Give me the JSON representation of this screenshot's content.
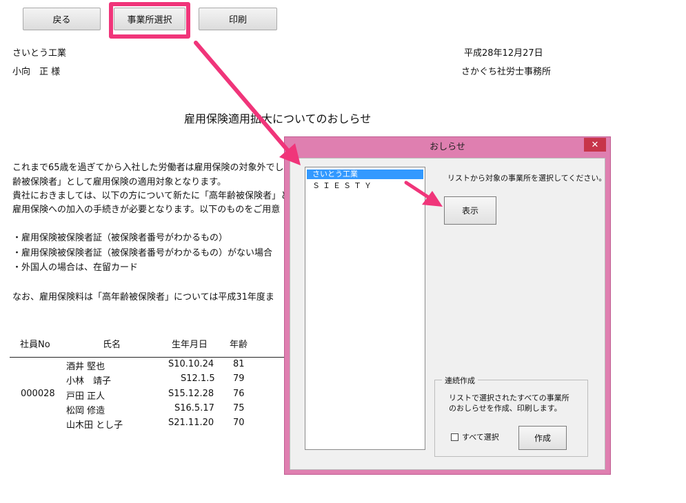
{
  "toolbar": {
    "back_label": "戻る",
    "select_office_label": "事業所選択",
    "print_label": "印刷"
  },
  "document": {
    "company": "さいとう工業",
    "recipient": "小向　正 様",
    "date": "平成28年12月27日",
    "sender": "さかぐち社労士事務所",
    "title": "雇用保険適用拡大についてのおしらせ",
    "lines": [
      "これまで65歳を過ぎてから入社した労働者は雇用保険の対象外でし",
      "齢被保険者」として雇用保険の適用対象となります。",
      "貴社におきましては、以下の方について新たに「高年齢被保険者」と",
      "雇用保険への加入の手続きが必要となります。以下のものをご用意",
      "",
      "・雇用保険被保険者証（被保険者番号がわかるもの）",
      "・雇用保険被保険者証（被保険者番号がわかるもの）がない場合",
      "・外国人の場合は、在留カード",
      "",
      "なお、雇用保険料は「高年齢被保険者」については平成31年度ま"
    ],
    "table": {
      "headers": [
        "社員No",
        "氏名",
        "生年月日",
        "年齢"
      ],
      "employee_no": "000028",
      "rows": [
        {
          "name": "酒井 堅也",
          "birth": "S10.10.24",
          "age": "81"
        },
        {
          "name": "小林　靖子",
          "birth": "S12.1.5",
          "age": "79"
        },
        {
          "name": "戸田 正人",
          "birth": "S15.12.28",
          "age": "76"
        },
        {
          "name": "松岡 修造",
          "birth": "S16.5.17",
          "age": "75"
        },
        {
          "name": "山木田 とし子",
          "birth": "S21.11.20",
          "age": "70"
        }
      ]
    }
  },
  "dialog": {
    "title": "おしらせ",
    "close_label": "✕",
    "list_items": [
      "さいとう工業",
      "ＳＩＥＳＴＹ"
    ],
    "selected_index": 0,
    "instruction": "リストから対象の事業所を選択してください。",
    "show_button_label": "表示",
    "batch_group": {
      "title": "連続作成",
      "desc_line1": "リストで選択されたすべての事業所",
      "desc_line2": "のおしらせを作成、印刷します。",
      "select_all_label": "すべて選択",
      "select_all_checked": false,
      "create_button_label": "作成"
    }
  },
  "colors": {
    "highlight": "#f0357a",
    "dialog_frame": "#df7fb0",
    "selection": "#3399ff",
    "close_button": "#c7354a"
  }
}
